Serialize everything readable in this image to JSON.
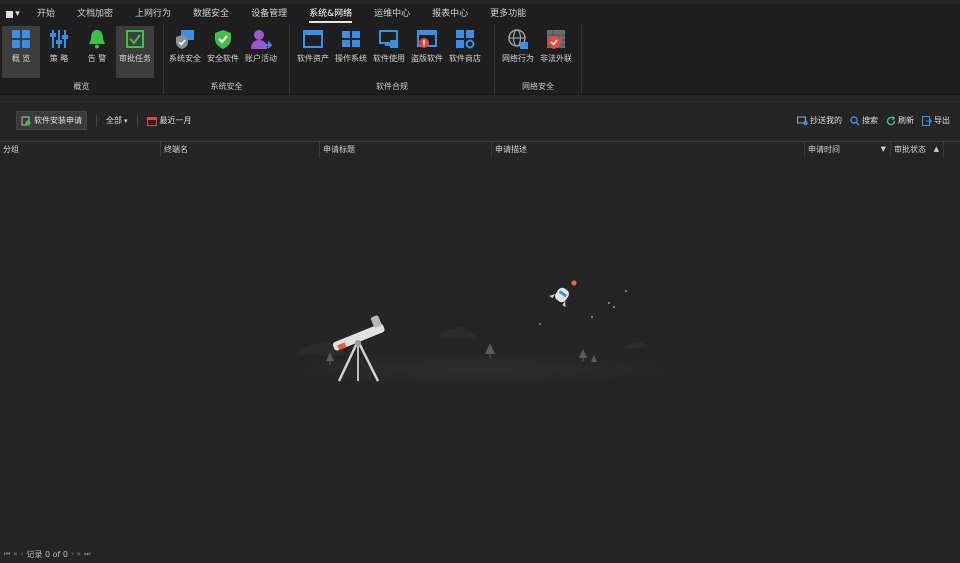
{
  "tabs": [
    {
      "label": "开始",
      "active": false
    },
    {
      "label": "文档加密",
      "active": false
    },
    {
      "label": "上网行为",
      "active": false
    },
    {
      "label": "数据安全",
      "active": false
    },
    {
      "label": "设备管理",
      "active": false
    },
    {
      "label": "系统&网络",
      "active": true
    },
    {
      "label": "运维中心",
      "active": false
    },
    {
      "label": "报表中心",
      "active": false
    },
    {
      "label": "更多功能",
      "active": false
    }
  ],
  "ribbon": {
    "groups": [
      {
        "label": "概览",
        "items": [
          {
            "label": "概 览",
            "icon": "grid-icon",
            "selected": true
          },
          {
            "label": "策 略",
            "icon": "sliders-icon",
            "selected": false
          },
          {
            "label": "告 警",
            "icon": "bell-icon",
            "selected": false
          },
          {
            "label": "审批任务",
            "icon": "checkbox-icon",
            "selected": true
          }
        ]
      },
      {
        "label": "系统安全",
        "items": [
          {
            "label": "系统安全",
            "icon": "shield-monitor-icon"
          },
          {
            "label": "安全软件",
            "icon": "shield-check-icon"
          },
          {
            "label": "账户活动",
            "icon": "user-arrow-icon"
          }
        ]
      },
      {
        "label": "软件合规",
        "items": [
          {
            "label": "软件资产",
            "icon": "window-icon"
          },
          {
            "label": "操作系统",
            "icon": "windows-logo-icon"
          },
          {
            "label": "软件使用",
            "icon": "monitor-icon"
          },
          {
            "label": "盗版软件",
            "icon": "window-alert-icon"
          },
          {
            "label": "软件商店",
            "icon": "store-icon"
          }
        ]
      },
      {
        "label": "网络安全",
        "items": [
          {
            "label": "网络行为",
            "icon": "globe-icon"
          },
          {
            "label": "非法外联",
            "icon": "firewall-icon"
          }
        ]
      }
    ]
  },
  "toolbar": {
    "apply_label": "软件安装申请",
    "filter_label": "全部",
    "range_label": "最近一月",
    "cc_label": "抄送我的",
    "search_label": "搜索",
    "refresh_label": "刷新",
    "export_label": "导出"
  },
  "columns": [
    "分组",
    "终端名",
    "申请标题",
    "申请描述",
    "申请时间",
    "审批状态"
  ],
  "status": {
    "record_label": "记录 0 of 0"
  },
  "colors": {
    "accent": "#2d8cf0",
    "green": "#3fbf4a",
    "red": "#e04a3a",
    "purple": "#9b59d0"
  }
}
